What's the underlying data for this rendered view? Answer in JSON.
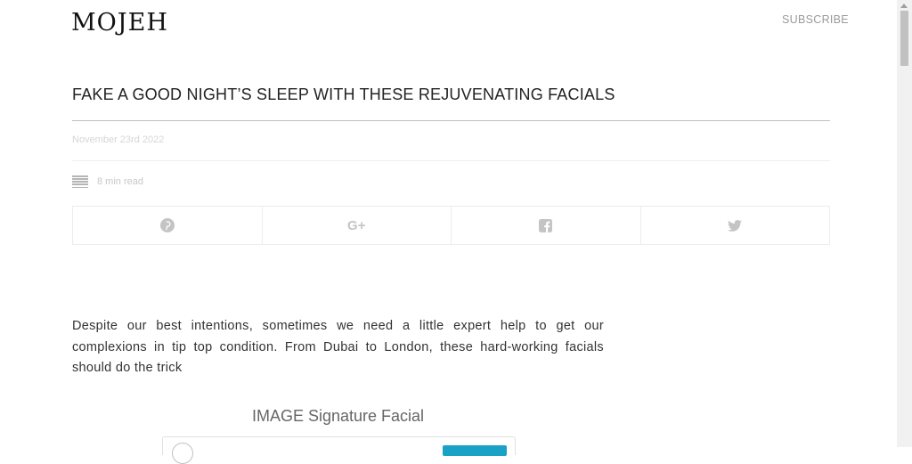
{
  "header": {
    "logo": "MOJEH",
    "subscribe_label": "SUBSCRIBE"
  },
  "article": {
    "title": "FAKE A GOOD NIGHT’S SLEEP WITH THESE REJUVENATING FACIALS",
    "date": "November 23rd 2022",
    "read_time": "8 min read",
    "intro": "Despite our best intentions, sometimes we need a little expert help to get our complexions in tip top condition. From Dubai to London, these hard-working facials should do the trick",
    "subhead": "IMAGE Signature Facial"
  },
  "share": {
    "items": [
      {
        "icon": "pinterest-icon"
      },
      {
        "icon": "google-plus-icon",
        "glyph": "G+"
      },
      {
        "icon": "facebook-icon"
      },
      {
        "icon": "twitter-icon"
      }
    ]
  },
  "colors": {
    "icon_gray": "#c4c4c4",
    "embed_button": "#1aa1c6"
  }
}
